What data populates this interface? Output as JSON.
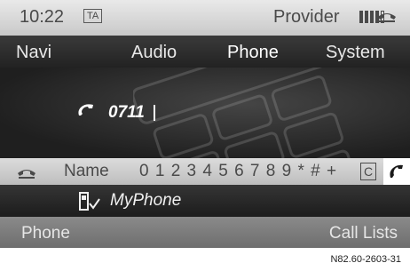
{
  "status": {
    "time": "10:22",
    "ta": "TA",
    "provider": "Provider"
  },
  "menu": {
    "navi": "Navi",
    "audio": "Audio",
    "phone": "Phone",
    "system": "System"
  },
  "dial": {
    "number": "0711"
  },
  "charbar": {
    "name": "Name",
    "chars": "0 1 2 3 4 5 6 7 8 9 * # +",
    "c_key": "C"
  },
  "device": {
    "name": "MyPhone"
  },
  "bottom": {
    "left": "Phone",
    "right": "Call Lists"
  },
  "caption": "N82.60-2603-31",
  "colors": {
    "statusbar": "#d8d8d8",
    "screen": "#2a2a2a",
    "bottombar": "#7c7c7c"
  },
  "icons": {
    "signal": "signal-strength-icon",
    "handset": "handset-hangup-icon",
    "call": "call-icon",
    "device": "mobile-device-icon"
  },
  "signal_strength": {
    "filled_bars": 4,
    "total_bars": 5
  }
}
